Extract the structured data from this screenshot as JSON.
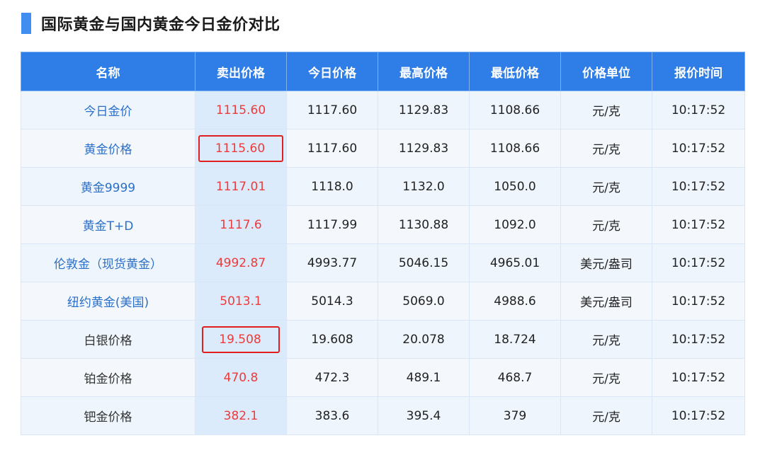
{
  "title": "国际黄金与国内黄金今日金价对比",
  "columns": [
    "名称",
    "卖出价格",
    "今日价格",
    "最高价格",
    "最低价格",
    "价格单位",
    "报价时间"
  ],
  "rows": [
    {
      "name": "今日金价",
      "sell": "1115.60",
      "today": "1117.60",
      "high": "1129.83",
      "low": "1108.66",
      "unit": "元/克",
      "time": "10:17:52"
    },
    {
      "name": "黄金价格",
      "sell": "1115.60",
      "today": "1117.60",
      "high": "1129.83",
      "low": "1108.66",
      "unit": "元/克",
      "time": "10:17:52"
    },
    {
      "name": "黄金9999",
      "sell": "1117.01",
      "today": "1118.0",
      "high": "1132.0",
      "low": "1050.0",
      "unit": "元/克",
      "time": "10:17:52"
    },
    {
      "name": "黄金T+D",
      "sell": "1117.6",
      "today": "1117.99",
      "high": "1130.88",
      "low": "1092.0",
      "unit": "元/克",
      "time": "10:17:52"
    },
    {
      "name": "伦敦金（现货黄金）",
      "sell": "4992.87",
      "today": "4993.77",
      "high": "5046.15",
      "low": "4965.01",
      "unit": "美元/盎司",
      "time": "10:17:52"
    },
    {
      "name": "纽约黄金(美国)",
      "sell": "5013.1",
      "today": "5014.3",
      "high": "5069.0",
      "low": "4988.6",
      "unit": "美元/盎司",
      "time": "10:17:52"
    },
    {
      "name": "白银价格",
      "sell": "19.508",
      "today": "19.608",
      "high": "20.078",
      "low": "18.724",
      "unit": "元/克",
      "time": "10:17:52"
    },
    {
      "name": "铂金价格",
      "sell": "470.8",
      "today": "472.3",
      "high": "489.1",
      "low": "468.7",
      "unit": "元/克",
      "time": "10:17:52"
    },
    {
      "name": "钯金价格",
      "sell": "382.1",
      "today": "383.6",
      "high": "395.4",
      "low": "379",
      "unit": "元/克",
      "time": "10:17:52"
    }
  ],
  "colors": {
    "header_bg": "#2f7de6",
    "accent": "#3f8ef0",
    "sell_text": "#ee3a3a",
    "link_text": "#2a6fc9",
    "highlight_border": "#e02020"
  }
}
